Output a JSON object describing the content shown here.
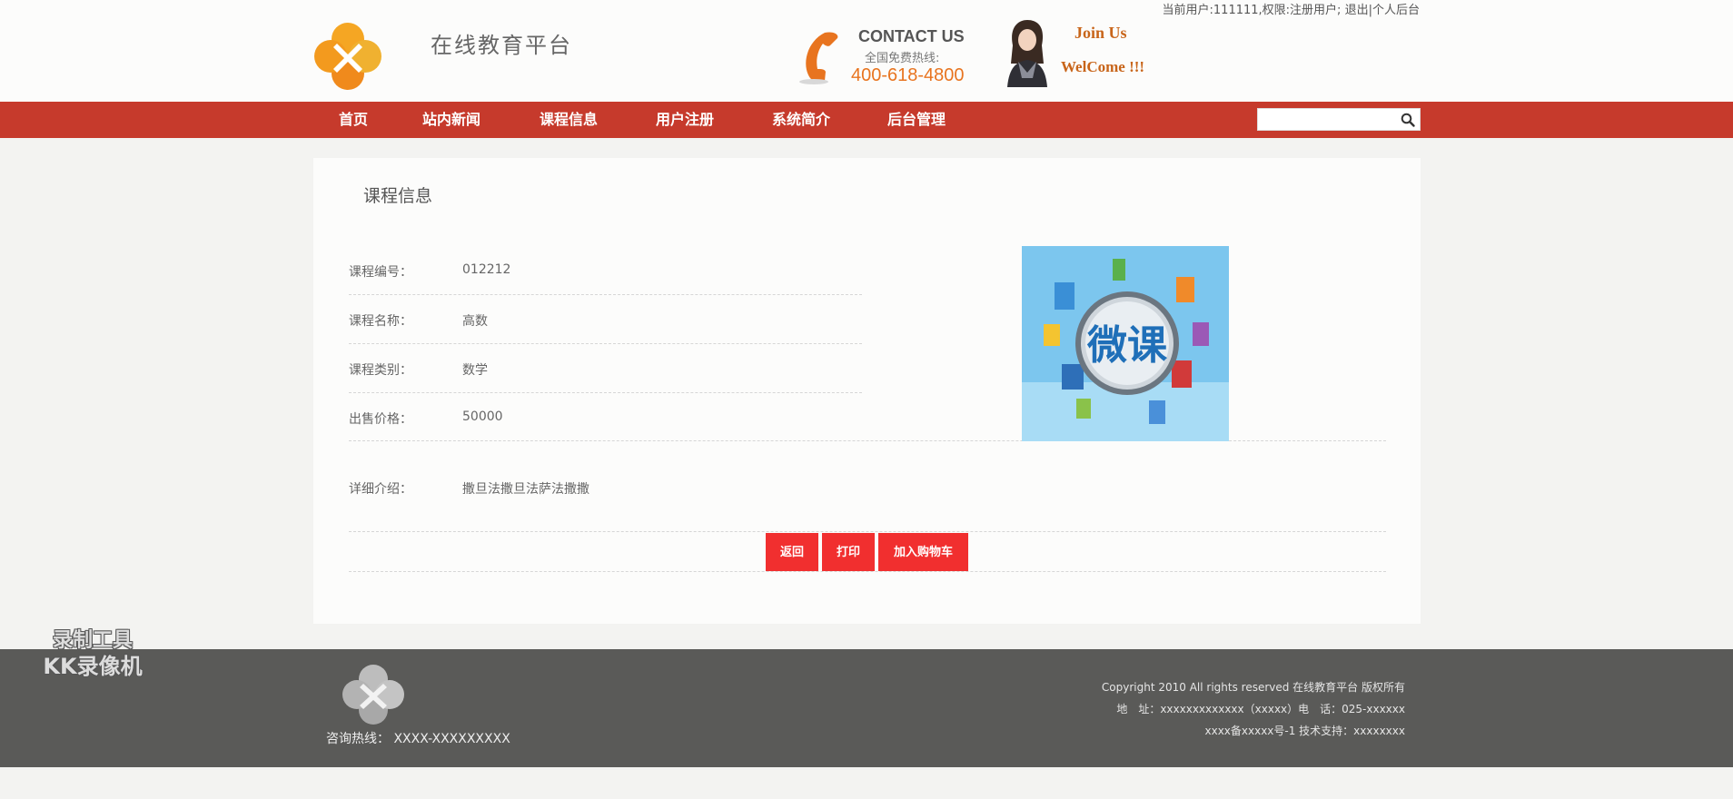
{
  "header": {
    "userbar": {
      "user_text": "当前用户:111111,权限:注册用户;",
      "logout": "退出",
      "separator": "|",
      "admin": "个人后台"
    },
    "site_title": "在线教育平台",
    "contact_title": "CONTACT US",
    "contact_sub": "全国免费热线:",
    "contact_phone": "400-618-4800",
    "join_us": "Join Us",
    "welcome": "WelCome !!!"
  },
  "nav": {
    "items": [
      {
        "label": "首页"
      },
      {
        "label": "站内新闻"
      },
      {
        "label": "课程信息"
      },
      {
        "label": "用户注册"
      },
      {
        "label": "系统简介"
      },
      {
        "label": "后台管理"
      }
    ],
    "search_placeholder": ""
  },
  "main": {
    "section_title": "课程信息",
    "fields": [
      {
        "label": "课程编号：",
        "value": "012212"
      },
      {
        "label": "课程名称：",
        "value": "高数"
      },
      {
        "label": "课程类别：",
        "value": "数学"
      },
      {
        "label": "出售价格：",
        "value": "50000"
      },
      {
        "label": "详细介绍：",
        "value": "撒旦法撒旦法萨法撒撒"
      }
    ],
    "image_text": "微课",
    "buttons": {
      "back": "返回",
      "print": "打印",
      "add_to_cart": "加入购物车"
    }
  },
  "footer": {
    "hotline_label": "咨询热线：",
    "hotline_value": "XXXX-XXXXXXXXX",
    "copyright": "Copyright 2010 All rights reserved 在线教育平台 版权所有",
    "address": "地　址：xxxxxxxxxxxxx（xxxxx）电　话：025-xxxxxx",
    "icp": "xxxx备xxxxx号-1 技术支持：xxxxxxxx"
  },
  "watermark": {
    "line1": "录制工具",
    "line2": "KK录像机"
  },
  "colors": {
    "nav_bg": "#c63a2c",
    "button_bg": "#f12f2f",
    "footer_bg": "#5a5a58",
    "accent_orange": "#e8741f"
  }
}
